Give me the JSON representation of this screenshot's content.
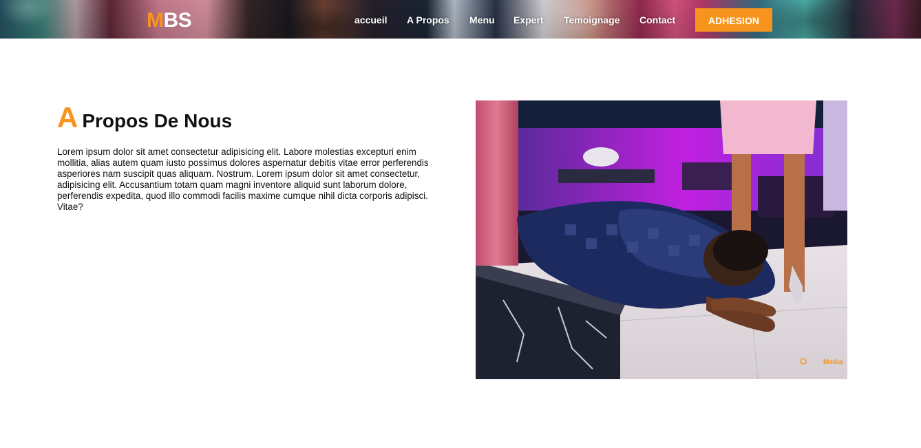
{
  "header": {
    "logo_accent": "M",
    "logo_rest": "BS",
    "nav": [
      "accueil",
      "A Propos",
      "Menu",
      "Expert",
      "Temoignage",
      "Contact"
    ],
    "cta_label": "ADHESION"
  },
  "about": {
    "title_accent": "A",
    "title_rest": "Propos De Nous",
    "paragraph": "Lorem ipsum dolor sit amet consectetur adipisicing elit. Labore molestias excepturi enim mollitia, alias autem quam iusto possimus dolores aspernatur debitis vitae error perferendis asperiores nam suscipit quas aliquam. Nostrum. Lorem ipsum dolor sit amet consectetur, adipisicing elit. Accusantium totam quam magni inventore aliquid sunt laborum dolore, perferendis expedita, quod illo commodi facilis maxime cumque nihil dicta corporis adipisci. Vitae?"
  },
  "photo": {
    "watermark_logo": "Media"
  },
  "colors": {
    "accent": "#f7941d",
    "text": "#111111",
    "background": "#ffffff"
  }
}
